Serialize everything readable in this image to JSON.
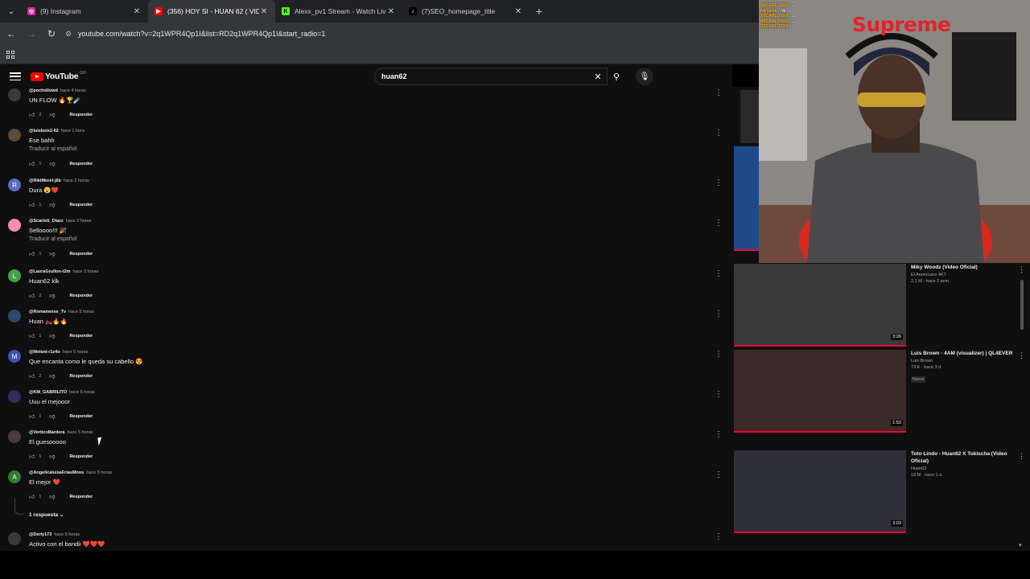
{
  "browser": {
    "tabs": [
      {
        "title": "(9) Instagram",
        "active": false,
        "icon": "instagram-icon"
      },
      {
        "title": "(356) HOY SI - HUAN 62 ( VIDE",
        "active": true,
        "icon": "youtube-icon"
      },
      {
        "title": "Alexx_pv1 Stream - Watch Live",
        "active": false,
        "icon": "kick-icon"
      },
      {
        "title": "(7)SEO_homepage_title",
        "active": false,
        "icon": "tiktok-icon"
      }
    ],
    "url": "youtube.com/watch?v=2q1WPR4Qp1I&list=RD2q1WPR4Qp1I&start_radio=1"
  },
  "youtube": {
    "logo_text": "YouTube",
    "country_code": "DO",
    "search_value": "huan62"
  },
  "comments": [
    {
      "user": "@pochollowd",
      "time": "hace 4 horas",
      "text": "UN FLOW 🔥🏆☄️",
      "translate": "",
      "likes": "2",
      "reply": "Responder",
      "avatar_letter": "",
      "avatar_color": "#3a3a3a"
    },
    {
      "user": "@luisbeis2-62",
      "time": "hace 1 hora",
      "text": "Ese bahh",
      "translate": "Traducir al español",
      "likes": "1",
      "reply": "Responder",
      "avatar_letter": "",
      "avatar_color": "#5a4a3a"
    },
    {
      "user": "@RikiMorel-jlib",
      "time": "hace 2 horas",
      "text": "Dura 😮❤️",
      "translate": "",
      "likes": "1",
      "reply": "Responder",
      "avatar_letter": "R",
      "avatar_color": "#5c6bc0"
    },
    {
      "user": "@Scarlett_Diazz",
      "time": "hace 3 horas",
      "text": "Selloooo!!! 🎉",
      "translate": "Traducir al español",
      "likes": "1",
      "reply": "Responder",
      "avatar_letter": "",
      "avatar_color": "#f48fb1"
    },
    {
      "user": "@LauraGrullon-t2m",
      "time": "hace 3 horas",
      "text": "Huan62 klk",
      "translate": "",
      "likes": "2",
      "reply": "Responder",
      "avatar_letter": "L",
      "avatar_color": "#43a047"
    },
    {
      "user": "@Romanense_Tv",
      "time": "hace 5 horas",
      "text": "Huan 🏍️🔥🔥",
      "translate": "",
      "likes": "1",
      "reply": "Responder",
      "avatar_letter": "",
      "avatar_color": "#2b4a6b"
    },
    {
      "user": "@Melani-r1z4o",
      "time": "hace 5 horas",
      "text": "Que encanta como le queda su cabello 😍",
      "translate": "",
      "likes": "2",
      "reply": "Responder",
      "avatar_letter": "M",
      "avatar_color": "#3f51b5"
    },
    {
      "user": "@KM_GABRILITO",
      "time": "hace 5 horas",
      "text": "Uuu el mejooor",
      "translate": "",
      "likes": "1",
      "reply": "Responder",
      "avatar_letter": "",
      "avatar_color": "#2d2d5a"
    },
    {
      "user": "@VerticoBardera",
      "time": "hace 5 horas",
      "text": "El guesooooo",
      "translate": "",
      "likes": "1",
      "reply": "Responder",
      "avatar_letter": "",
      "avatar_color": "#4a3a3a"
    },
    {
      "user": "@AngelicaluisaFriasMoos",
      "time": "hace 5 horas",
      "text": "El mejor ❤️",
      "translate": "",
      "likes": "1",
      "reply": "Responder",
      "avatar_letter": "A",
      "avatar_color": "#2e7d32"
    },
    {
      "user": "@Derly173",
      "time": "hace 6 horas",
      "text": "Activo con el bandii ❤️❤️❤️",
      "translate": "",
      "likes": "",
      "reply": "",
      "avatar_letter": "",
      "avatar_color": "#3a3a3a"
    }
  ],
  "replies_toggle": "1 respuesta",
  "sidebar_videos": [
    {
      "title": "Miky Woodz (Video Oficial)",
      "channel": "El Americano 4KT",
      "meta": "2,1 M · hace 2 sem.",
      "badge": "",
      "duration": "3:26",
      "thumb": "#3a3a3a"
    },
    {
      "title": "Luis Brown - 4AM (visualizer) | QL4EVER",
      "channel": "Luis Brown",
      "meta": "73 K · hace 3 d",
      "badge": "Nuevo",
      "duration": "1:53",
      "thumb": "#3b2a2a"
    },
    {
      "title": "Toto Lindo - Huan62 X Tokischa (Video Oficial)",
      "channel": "Huan62",
      "meta": "19 M · hace 1 a",
      "badge": "",
      "duration": "3:03",
      "thumb": "#30303a"
    }
  ],
  "stream": {
    "brand_text": "Supreme",
    "chat": [
      {
        "user": "XXCARLOSXX :",
        "msg": "..."
      },
      {
        "user": "NKYandy :",
        "msg": "W"
      },
      {
        "user": "XXCARLOSXX :",
        "msg": "..."
      },
      {
        "user": "XXCARLOSXX :",
        "msg": "..."
      },
      {
        "user": "XXCARLOSXX :",
        "msg": "..."
      }
    ]
  },
  "colors": {
    "youtube_red": "#ff0000",
    "supreme_red": "#e2232a"
  }
}
